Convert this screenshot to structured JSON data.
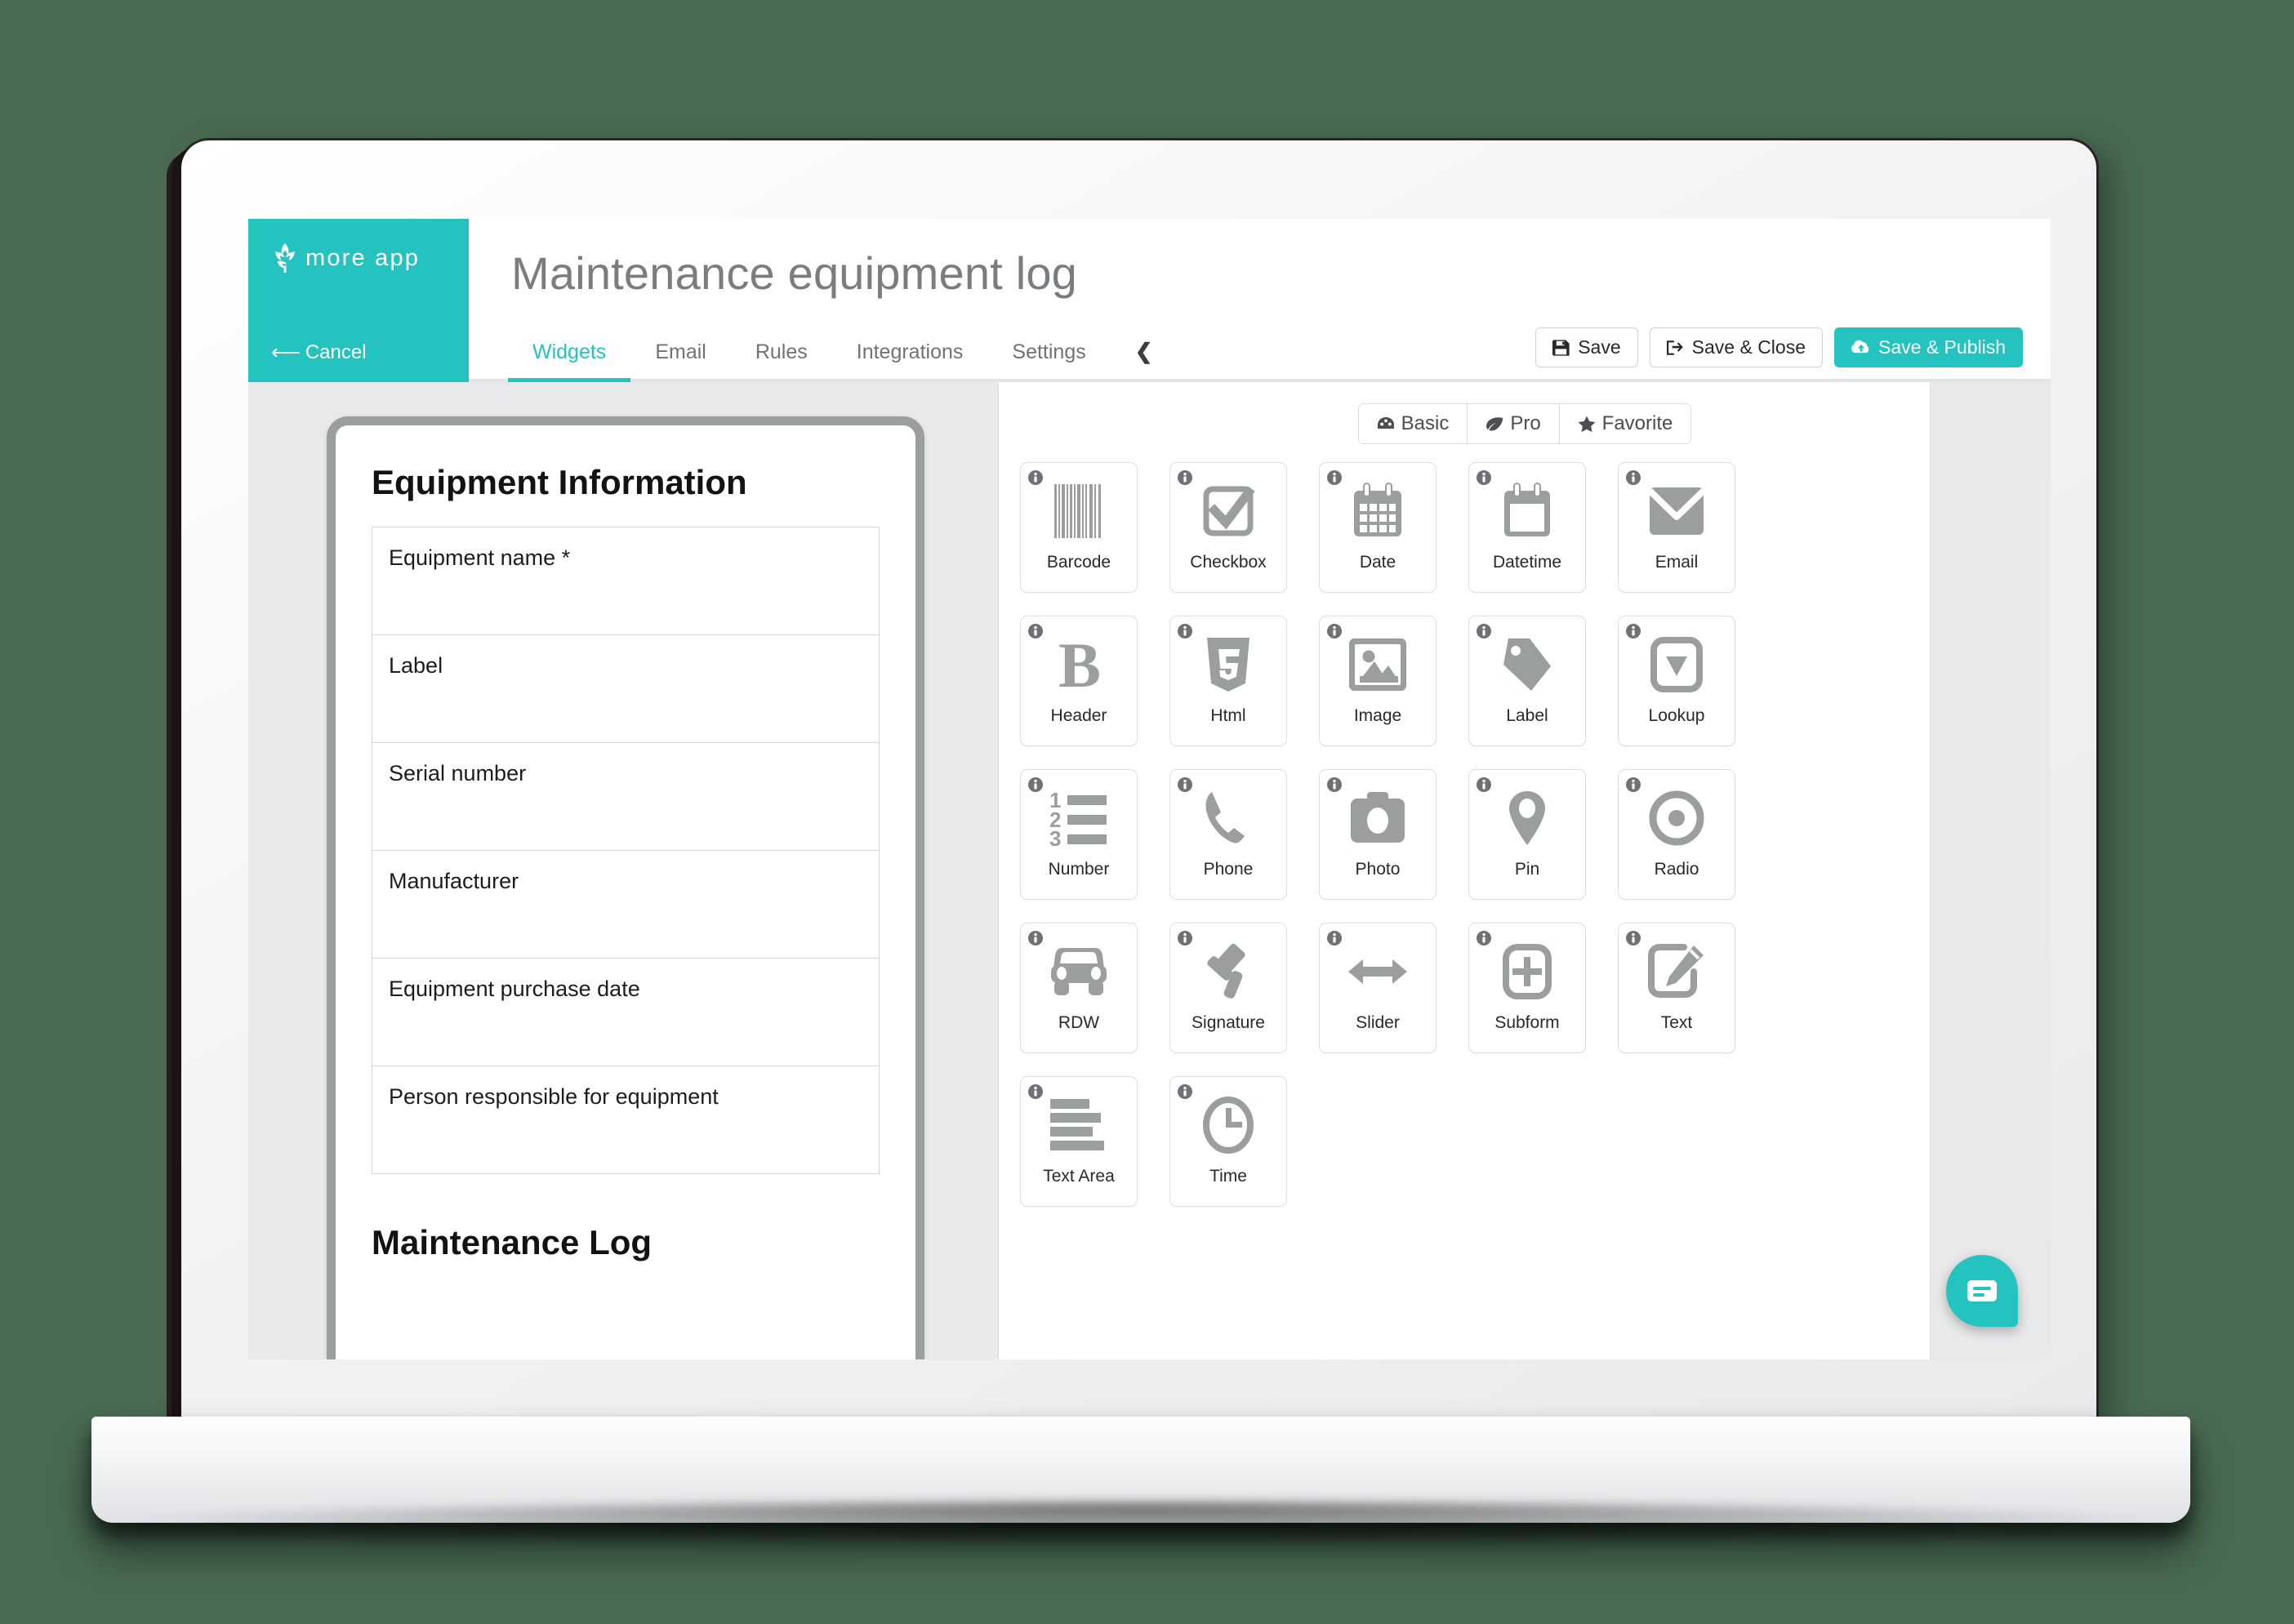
{
  "brand": {
    "logo_icon": "wheat-leaf-icon",
    "name": "more app",
    "cancel_label": "Cancel",
    "accent_color": "#25c3bf"
  },
  "header": {
    "title": "Maintenance equipment log",
    "tabs": [
      {
        "label": "Widgets",
        "active": true
      },
      {
        "label": "Email",
        "active": false
      },
      {
        "label": "Rules",
        "active": false
      },
      {
        "label": "Integrations",
        "active": false
      },
      {
        "label": "Settings",
        "active": false
      }
    ],
    "collapse_icon": "chevron-left-icon",
    "actions": [
      {
        "label": "Save",
        "icon": "floppy-disk-icon",
        "primary": false
      },
      {
        "label": "Save & Close",
        "icon": "sign-out-icon",
        "primary": false
      },
      {
        "label": "Save & Publish",
        "icon": "cloud-upload-icon",
        "primary": true
      }
    ]
  },
  "preview": {
    "sections": [
      {
        "title": "Equipment Information",
        "fields": [
          {
            "label": "Equipment name *"
          },
          {
            "label": "Label"
          },
          {
            "label": "Serial number"
          },
          {
            "label": "Manufacturer"
          },
          {
            "label": "Equipment purchase date"
          },
          {
            "label": "Person responsible for equipment"
          }
        ]
      },
      {
        "title": "Maintenance Log",
        "fields": []
      }
    ]
  },
  "widgets_panel": {
    "filters": [
      {
        "label": "Basic",
        "icon": "puzzle-icon",
        "active": true
      },
      {
        "label": "Pro",
        "icon": "leaf-icon",
        "active": false
      },
      {
        "label": "Favorite",
        "icon": "star-icon",
        "active": false
      }
    ],
    "info_badge_icon": "info-circle-icon",
    "widgets": [
      {
        "label": "Barcode",
        "icon": "barcode-icon"
      },
      {
        "label": "Checkbox",
        "icon": "checkbox-icon"
      },
      {
        "label": "Date",
        "icon": "calendar-icon"
      },
      {
        "label": "Datetime",
        "icon": "calendar-blank-icon"
      },
      {
        "label": "Email",
        "icon": "envelope-icon"
      },
      {
        "label": "Header",
        "icon": "bold-b-icon"
      },
      {
        "label": "Html",
        "icon": "html5-shield-icon"
      },
      {
        "label": "Image",
        "icon": "picture-icon"
      },
      {
        "label": "Label",
        "icon": "tag-icon"
      },
      {
        "label": "Lookup",
        "icon": "dropdown-icon"
      },
      {
        "label": "Number",
        "icon": "numbered-list-icon"
      },
      {
        "label": "Phone",
        "icon": "phone-icon"
      },
      {
        "label": "Photo",
        "icon": "camera-icon"
      },
      {
        "label": "Pin",
        "icon": "map-pin-icon"
      },
      {
        "label": "Radio",
        "icon": "radio-button-icon"
      },
      {
        "label": "RDW",
        "icon": "car-icon"
      },
      {
        "label": "Signature",
        "icon": "gavel-icon"
      },
      {
        "label": "Slider",
        "icon": "arrows-horizontal-icon"
      },
      {
        "label": "Subform",
        "icon": "plus-square-icon"
      },
      {
        "label": "Text",
        "icon": "pencil-edit-icon"
      },
      {
        "label": "Text Area",
        "icon": "text-lines-icon"
      },
      {
        "label": "Time",
        "icon": "clock-icon"
      }
    ]
  },
  "chat": {
    "icon": "chat-bubble-icon"
  }
}
